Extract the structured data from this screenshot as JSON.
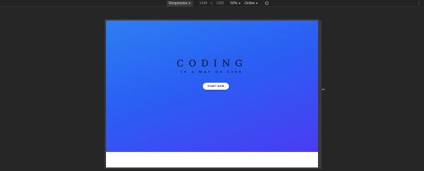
{
  "devtools": {
    "device_label": "Responsive",
    "width_value": "1448",
    "times_sign": "x",
    "height_value": "1005",
    "zoom_label": "50%",
    "throttle_label": "Online",
    "colors": {
      "toolbar_bg": "#232323",
      "canvas_bg": "#262626"
    }
  },
  "page": {
    "hero": {
      "title": "CODING",
      "subtitle": "IS A WAY OF LIFE",
      "cta_label": "START NOW",
      "gradient": [
        "#2c7ff2",
        "#2a5ff3",
        "#4a3cf2"
      ]
    }
  },
  "icons": {
    "caret": "caret-down-icon",
    "rotate": "rotate-icon",
    "more": "more-vertical-icon",
    "resize": "resize-horizontal-icon"
  }
}
